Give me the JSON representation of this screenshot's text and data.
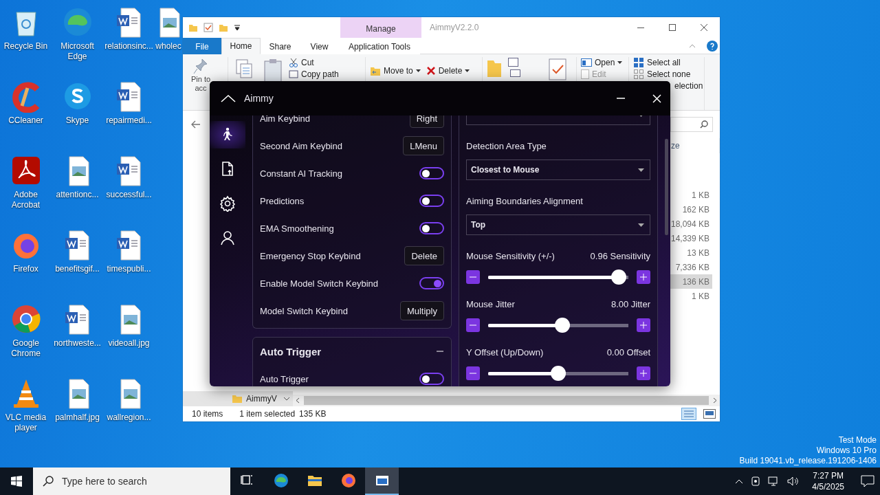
{
  "desktop_icons": [
    {
      "label": "Recycle Bin",
      "kind": "recycle"
    },
    {
      "label": "CCleaner",
      "kind": "ccleaner"
    },
    {
      "label": "Adobe Acrobat",
      "kind": "acrobat"
    },
    {
      "label": "Firefox",
      "kind": "firefox"
    },
    {
      "label": "Google Chrome",
      "kind": "chrome"
    },
    {
      "label": "VLC media player",
      "kind": "vlc"
    },
    {
      "label": "Microsoft Edge",
      "kind": "edge"
    },
    {
      "label": "Skype",
      "kind": "skype"
    },
    {
      "label": "attentionc...",
      "kind": "image"
    },
    {
      "label": "benefitsgif...",
      "kind": "word"
    },
    {
      "label": "northweste...",
      "kind": "word"
    },
    {
      "label": "palmhalf.jpg",
      "kind": "image"
    },
    {
      "label": "relationsinc...",
      "kind": "word"
    },
    {
      "label": "repairmedi...",
      "kind": "word"
    },
    {
      "label": "successful...",
      "kind": "word"
    },
    {
      "label": "timespubli...",
      "kind": "word"
    },
    {
      "label": "videoall.jpg",
      "kind": "image"
    },
    {
      "label": "wallregion...",
      "kind": "image"
    },
    {
      "label": "wholec",
      "kind": "image"
    }
  ],
  "explorer": {
    "title": "AimmyV2.2.0",
    "context_tab": "Manage",
    "tabs": [
      {
        "label": "File",
        "kind": "file",
        "selected": false
      },
      {
        "label": "Home",
        "kind": "tab",
        "selected": true
      },
      {
        "label": "Share",
        "kind": "tab",
        "selected": false
      },
      {
        "label": "View",
        "kind": "tab",
        "selected": false
      },
      {
        "label": "Application Tools",
        "kind": "context",
        "selected": false
      }
    ],
    "ribbon": {
      "pin": [
        "Pin to",
        "acc"
      ],
      "cut": "Cut",
      "copy_path": "Copy path",
      "move_to": "Move to",
      "delete": "Delete",
      "open": "Open",
      "edit": "Edit",
      "select_all": "Select all",
      "select_none": "Select none",
      "invert": "election"
    },
    "size_header": "ze",
    "sizes": [
      {
        "text": "1 KB",
        "selected": false
      },
      {
        "text": "162 KB",
        "selected": false
      },
      {
        "text": "18,094 KB",
        "selected": false
      },
      {
        "text": "14,339 KB",
        "selected": false
      },
      {
        "text": "13 KB",
        "selected": false
      },
      {
        "text": "7,336 KB",
        "selected": false
      },
      {
        "text": "136 KB",
        "selected": true
      },
      {
        "text": "1 KB",
        "selected": false
      }
    ],
    "nav_item": "AimmyV",
    "status": {
      "items": "10 items",
      "selection": "1 item selected",
      "size": "135 KB"
    }
  },
  "aimmy": {
    "title": "Aimmy",
    "nav": [
      {
        "kind": "aim",
        "selected": true
      },
      {
        "kind": "models",
        "selected": false
      },
      {
        "kind": "settings",
        "selected": false
      },
      {
        "kind": "account",
        "selected": false
      }
    ],
    "left_rows": [
      {
        "kind": "keybind",
        "label": "Aim Keybind",
        "value": "Right"
      },
      {
        "kind": "keybind",
        "label": "Second Aim Keybind",
        "value": "LMenu"
      },
      {
        "kind": "toggle",
        "label": "Constant AI Tracking",
        "on": false
      },
      {
        "kind": "toggle",
        "label": "Predictions",
        "on": false
      },
      {
        "kind": "toggle",
        "label": "EMA Smoothening",
        "on": false
      },
      {
        "kind": "keybind",
        "label": "Emergency Stop Keybind",
        "value": "Delete"
      },
      {
        "kind": "toggle",
        "label": "Enable Model Switch Keybind",
        "on": true
      },
      {
        "kind": "keybind",
        "label": "Model Switch Keybind",
        "value": "Multiply"
      }
    ],
    "trigger_section": {
      "title": "Auto Trigger",
      "expanded": true,
      "rows": [
        {
          "kind": "toggle",
          "label": "Auto Trigger",
          "on": false
        }
      ]
    },
    "right_rows": [
      {
        "kind": "dropdown"
      },
      {
        "kind": "dropdown",
        "label": "Detection Area Type",
        "value": "Closest to Mouse"
      },
      {
        "kind": "dropdown",
        "label": "Aiming Boundaries Alignment",
        "value": "Top"
      },
      {
        "kind": "slider",
        "label": "Mouse Sensitivity (+/-)",
        "reading": "0.96 Sensitivity",
        "level": 0.93
      },
      {
        "kind": "slider",
        "label": "Mouse Jitter",
        "reading": "8.00 Jitter",
        "level": 0.53
      },
      {
        "kind": "slider",
        "label": "Y Offset (Up/Down)",
        "reading": "0.00 Offset",
        "level": 0.5
      }
    ]
  },
  "os_watermark": [
    "Test Mode",
    "Windows 10 Pro",
    "Build 19041.vb_release.191206-1406"
  ],
  "taskbar": {
    "search_placeholder": "Type here to search",
    "apps": [
      {
        "kind": "taskview",
        "selected": false
      },
      {
        "kind": "edge",
        "selected": false
      },
      {
        "kind": "explorer",
        "selected": false
      },
      {
        "kind": "firefox",
        "selected": false
      },
      {
        "kind": "aimmy",
        "selected": true
      }
    ],
    "time": "7:27 PM",
    "date": "4/5/2025"
  }
}
